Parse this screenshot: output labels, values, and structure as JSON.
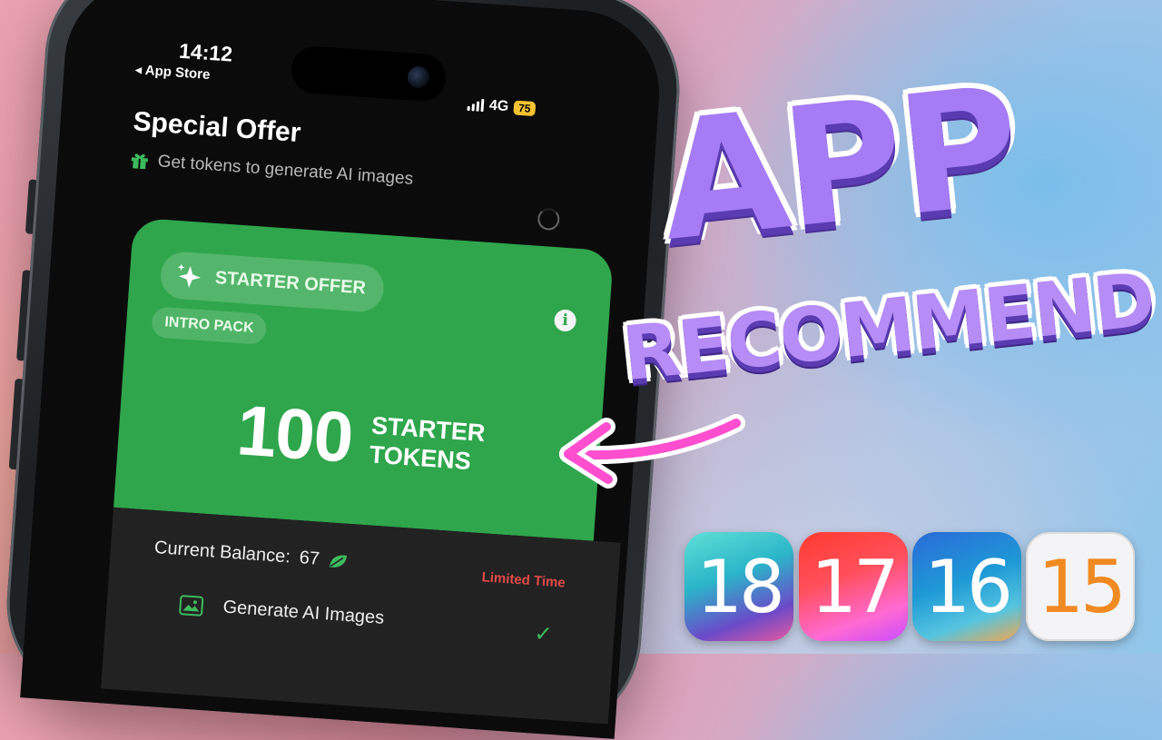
{
  "status_bar": {
    "time": "14:12",
    "back_label": "◂ App Store",
    "network": "4G",
    "battery": "75"
  },
  "screen": {
    "title": "Special Offer",
    "subtitle": "Get tokens to generate AI images"
  },
  "offer_card": {
    "badge": "STARTER OFFER",
    "tag": "INTRO PACK",
    "info_icon": "i",
    "token_count": "100",
    "token_label_line1": "STARTER",
    "token_label_line2": "TOKENS",
    "color": "#2fa64c"
  },
  "details": {
    "balance_label": "Current Balance:",
    "balance_value": "67",
    "limited": "Limited Time",
    "feature_generate": "Generate AI Images",
    "check_icon": "✓"
  },
  "headline": {
    "line1": "APP",
    "line2": "RECOMMEND"
  },
  "ios_versions": [
    "18",
    "17",
    "16",
    "15"
  ],
  "icons": {
    "gift": "gift-icon",
    "sparkle": "sparkle-icon",
    "leaf": "leaf-icon",
    "image": "image-icon",
    "arrow": "arrow-icon"
  }
}
